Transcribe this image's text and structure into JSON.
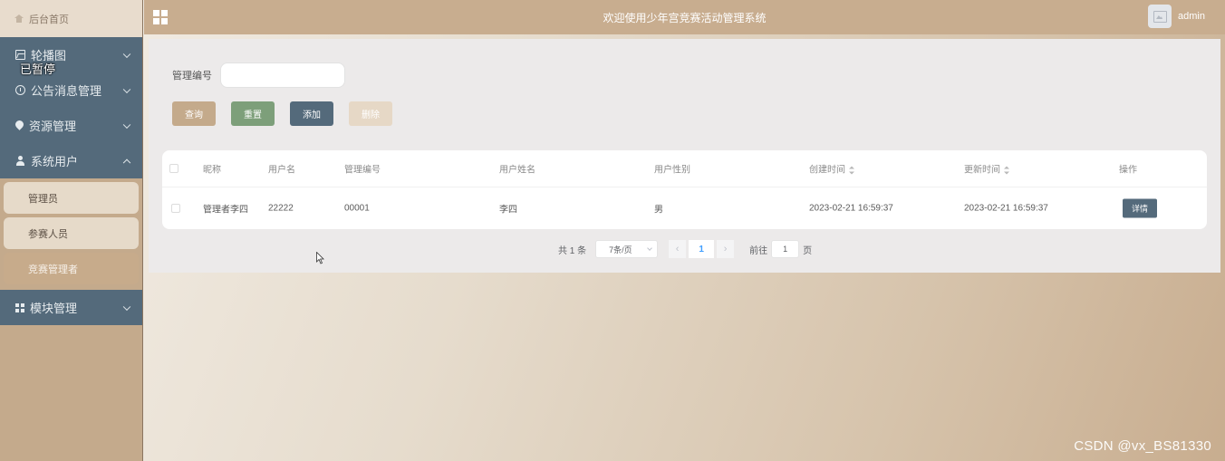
{
  "sidebar": {
    "home": "后台首页",
    "paused_overlay": "已暂停",
    "items": [
      {
        "label": "轮播图",
        "icon": "image-icon"
      },
      {
        "label": "公告消息管理",
        "icon": "info-icon"
      },
      {
        "label": "资源管理",
        "icon": "location-icon"
      },
      {
        "label": "系统用户",
        "icon": "user-icon",
        "expanded": true
      },
      {
        "label": "模块管理",
        "icon": "grid-icon"
      }
    ],
    "subitems": [
      {
        "label": "管理员"
      },
      {
        "label": "参赛人员"
      },
      {
        "label": "竞赛管理者",
        "active": true
      }
    ]
  },
  "header": {
    "title": "欢迎使用少年宫竞赛活动管理系统",
    "username": "admin"
  },
  "search": {
    "label": "管理编号",
    "placeholder": "",
    "value": ""
  },
  "buttons": {
    "query": "查询",
    "reset": "重置",
    "add": "添加",
    "delete": "删除"
  },
  "table": {
    "columns": [
      "昵称",
      "用户名",
      "管理编号",
      "用户姓名",
      "用户性别",
      "创建时间",
      "更新时间",
      "操作"
    ],
    "rows": [
      {
        "nickname": "管理者李四",
        "username": "22222",
        "manage_no": "00001",
        "realname": "李四",
        "gender": "男",
        "created": "2023-02-21 16:59:37",
        "updated": "2023-02-21 16:59:37",
        "action": "详情"
      }
    ]
  },
  "pagination": {
    "total": "共 1 条",
    "page_size": "7条/页",
    "current_page": "1",
    "prev": "‹",
    "next": "›",
    "jump_label": "前往",
    "jump_value": "1",
    "page_suffix": "页"
  },
  "watermark": "CSDN @vx_BS81330",
  "colors": {
    "sidebar_menu": "#546a7b",
    "accent_tan": "#c4aa8b",
    "reset_green": "#7d9f7a",
    "page_link": "#409eff"
  }
}
